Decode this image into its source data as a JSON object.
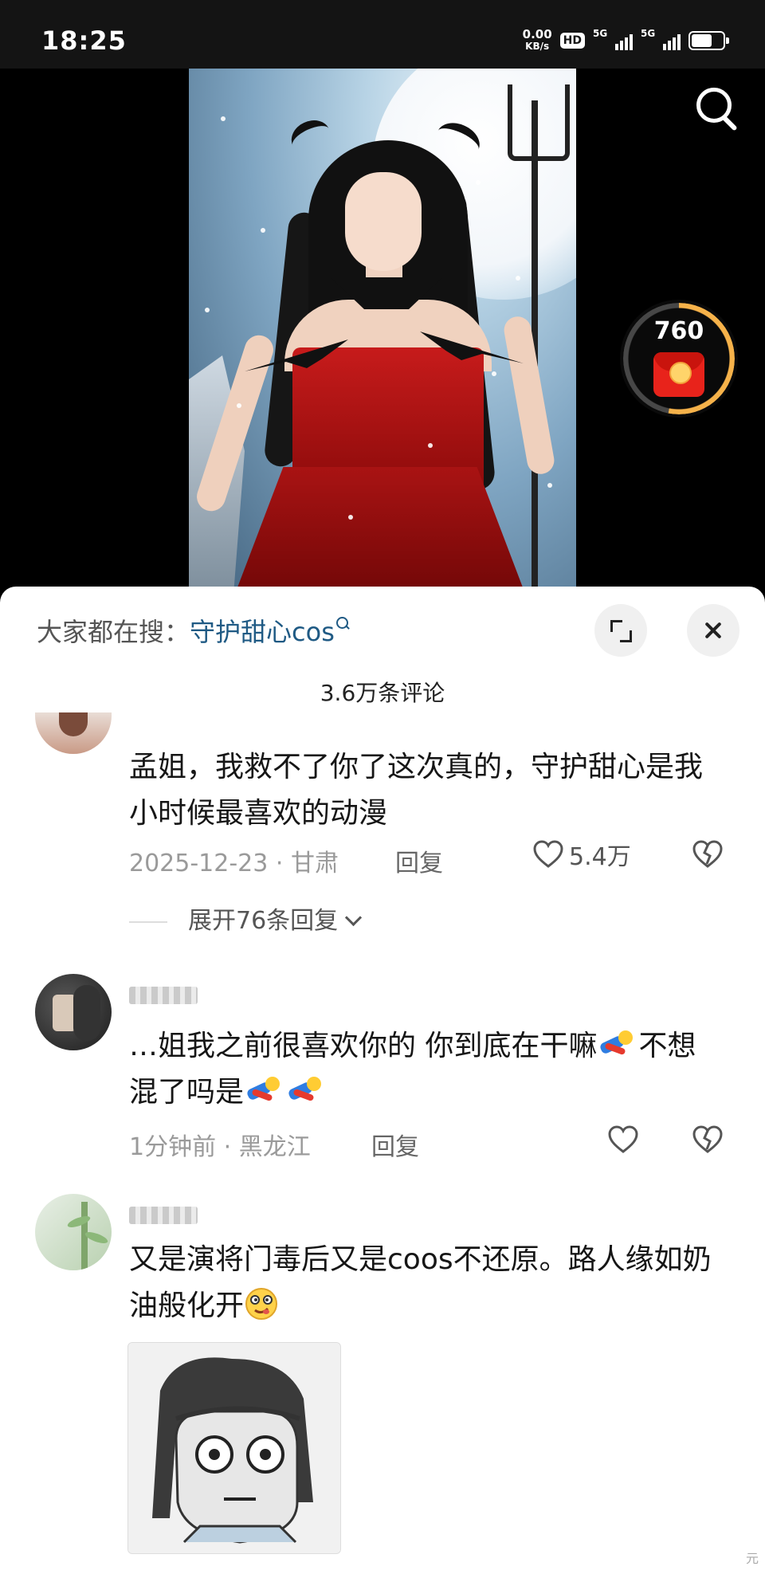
{
  "status_bar": {
    "time": "18:25",
    "net_speed_value": "0.00",
    "net_speed_unit": "KB/s",
    "hd_badge": "HD",
    "sim1": "5G",
    "sim2": "5G"
  },
  "video": {
    "search_icon": "search-icon",
    "red_packet_count": "760"
  },
  "panel": {
    "trending_label": "大家都在搜：",
    "trending_query": "守护甜心cos",
    "comment_count": "3.6万条评论"
  },
  "comments": [
    {
      "text": "孟姐，我救不了你了这次真的，守护甜心是我小时候最喜欢的动漫",
      "date": "2025-12-23",
      "location": "甘肃",
      "reply_label": "回复",
      "likes": "5.4万",
      "expand_replies": "展开76条回复"
    },
    {
      "text": "…姐我之前很喜欢你的 你到底在干嘛",
      "text_mid": "不想混了吗是",
      "date": "1分钟前",
      "location": "黑龙江",
      "reply_label": "回复"
    },
    {
      "text": "又是演将门毒后又是coos不还原。路人缘如奶油般化开",
      "date": "",
      "location": ""
    }
  ],
  "watermark": "元",
  "colors": {
    "link": "#1f5a84",
    "meta": "#9a9a9a",
    "red_packet": "#e8231b",
    "progress": "#f6b24a"
  },
  "red_packet_progress": 0.53
}
